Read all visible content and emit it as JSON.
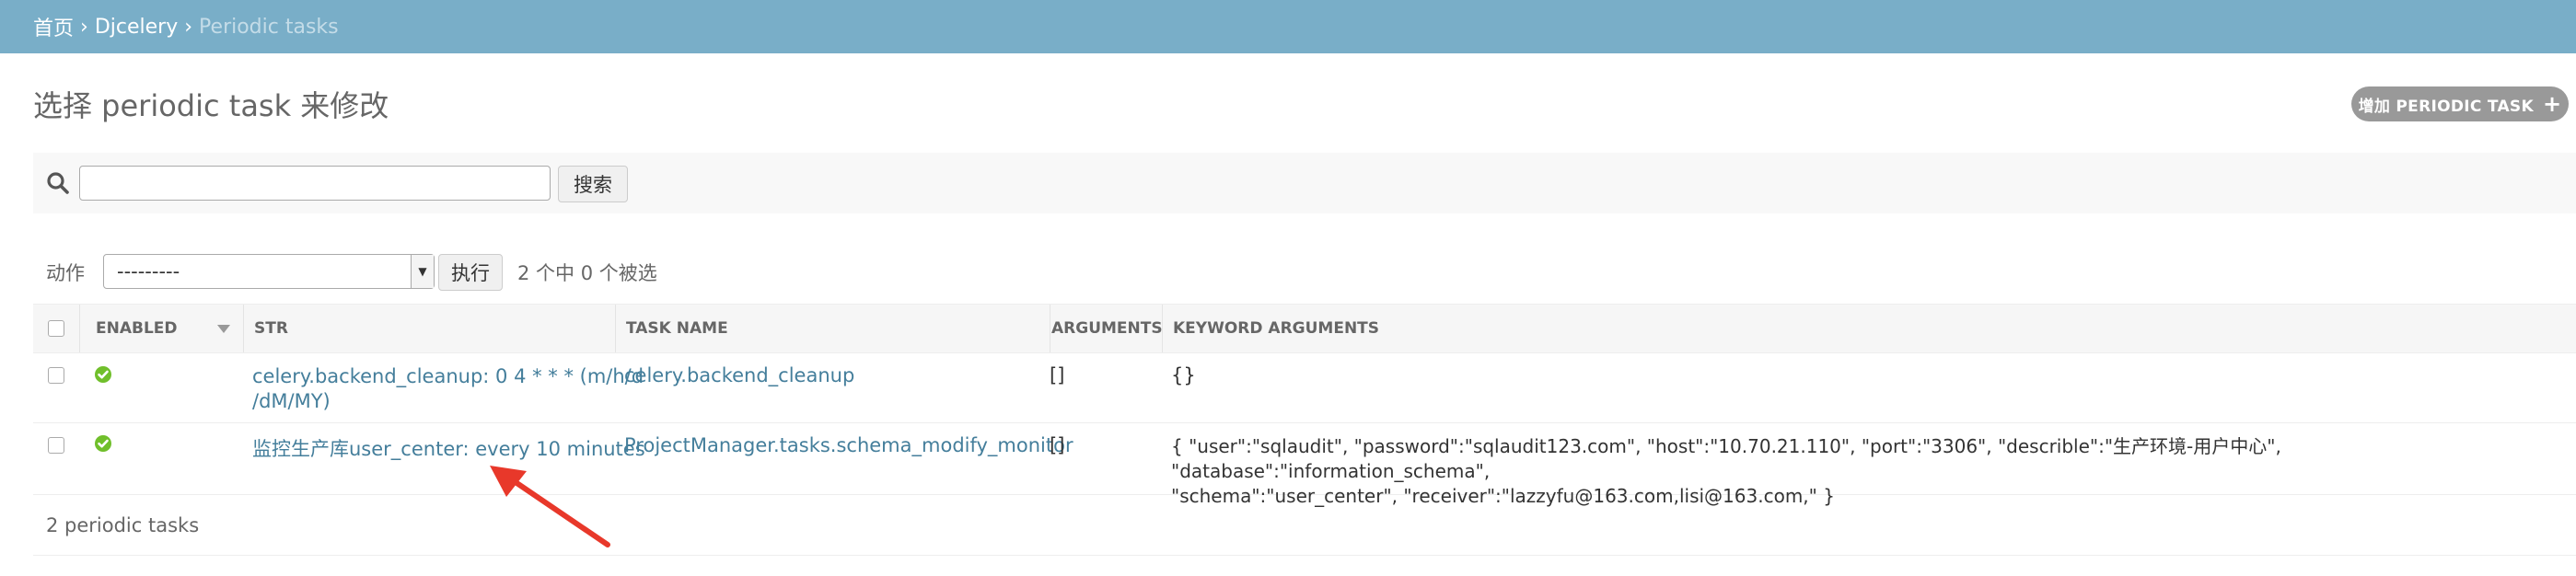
{
  "breadcrumbs": {
    "home": "首页",
    "app": "Djcelery",
    "current": "Periodic tasks",
    "separator": "›"
  },
  "page": {
    "title": "选择 periodic task 来修改",
    "add_button": "增加 PERIODIC TASK",
    "add_icon": "plus-icon"
  },
  "search": {
    "value": "",
    "placeholder": "",
    "button": "搜索"
  },
  "actions": {
    "label": "动作",
    "selected": "---------",
    "go_button": "执行",
    "selection_count": "2 个中 0 个被选"
  },
  "table": {
    "columns": [
      "ENABLED",
      "STR",
      "TASK NAME",
      "ARGUMENTS",
      "KEYWORD ARGUMENTS"
    ],
    "rows": [
      {
        "enabled": true,
        "str_line1": "celery.backend_cleanup: 0 4 * * * (m/h/d",
        "str_line2": "/dM/MY)",
        "task_name": "celery.backend_cleanup",
        "arguments": "[]",
        "kwargs_line1": "{}",
        "kwargs_line2": ""
      },
      {
        "enabled": true,
        "str_line1": "监控生产库user_center: every 10 minutes",
        "str_line2": "",
        "task_name": "ProjectManager.tasks.schema_modify_monitor",
        "arguments": "[]",
        "kwargs_line1": "{ \"user\":\"sqlaudit\", \"password\":\"sqlaudit123.com\", \"host\":\"10.70.21.110\", \"port\":\"3306\", \"describle\":\"生产环境-用户中心\", \"database\":\"information_schema\",",
        "kwargs_line2": "\"schema\":\"user_center\", \"receiver\":\"lazzyfu@163.com,lisi@163.com,\" }"
      }
    ],
    "footer": "2 periodic tasks"
  },
  "colors": {
    "header_bg": "#79aec8",
    "link": "#447e9b",
    "enabled_icon": "#70bf2b",
    "annotation_arrow": "#e8382a"
  }
}
